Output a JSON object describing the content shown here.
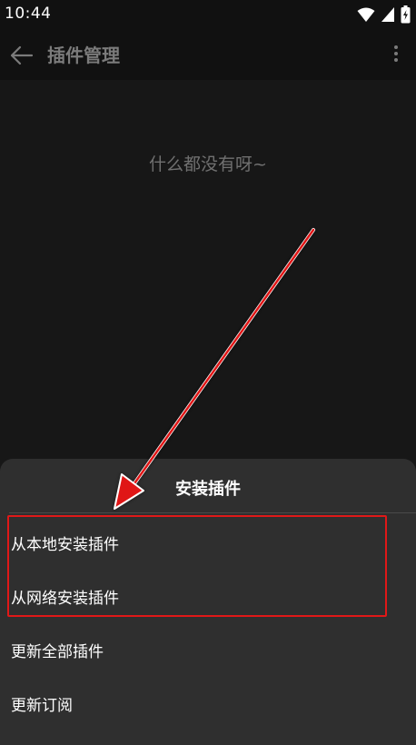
{
  "status_bar": {
    "time": "10:44"
  },
  "app_bar": {
    "title": "插件管理"
  },
  "content": {
    "empty_text": "什么都没有呀~"
  },
  "sheet": {
    "title": "安装插件",
    "items": [
      {
        "label": "从本地安装插件"
      },
      {
        "label": "从网络安装插件"
      },
      {
        "label": "更新全部插件"
      },
      {
        "label": "更新订阅"
      }
    ]
  },
  "colors": {
    "accent_red": "#e01818",
    "sheet_bg": "#2f2f2f",
    "app_bg": "#171717"
  }
}
